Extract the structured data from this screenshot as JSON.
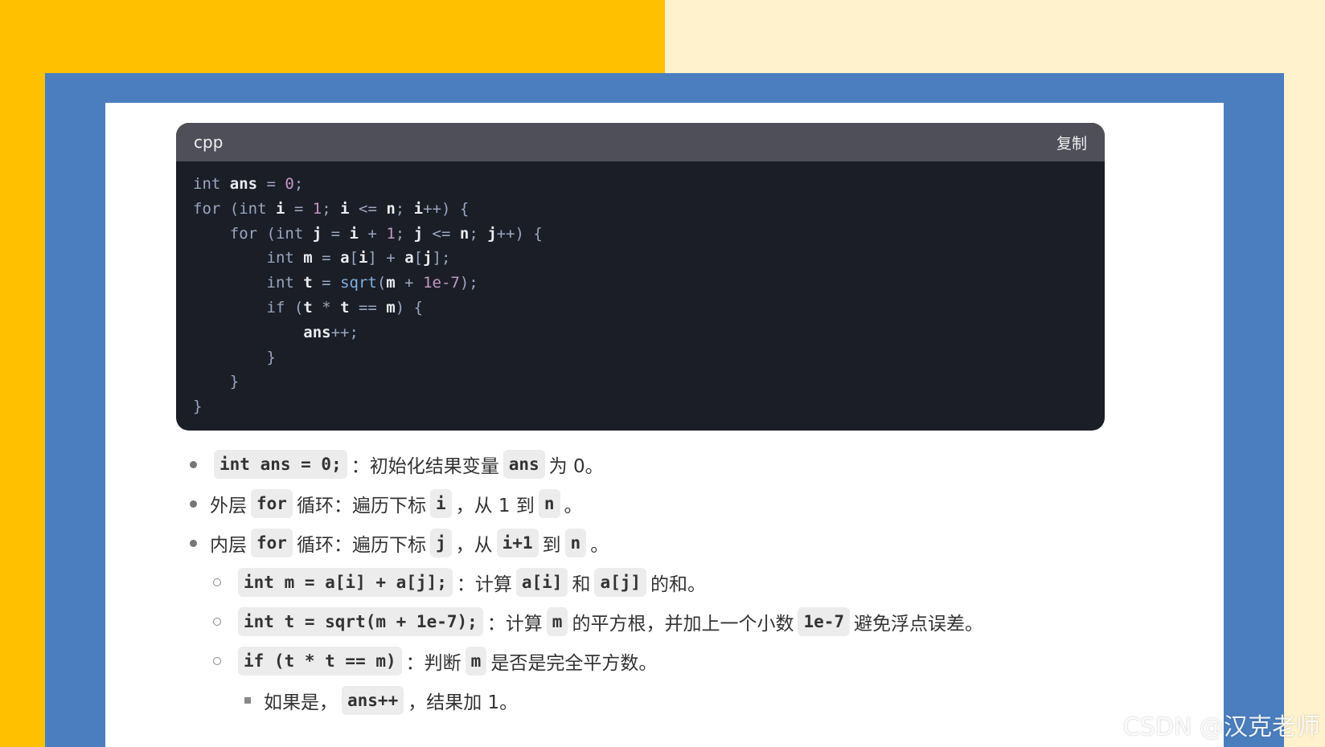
{
  "code_block": {
    "language": "cpp",
    "copy_label": "复制",
    "lines": [
      [
        [
          "kw",
          "int "
        ],
        [
          "id",
          "ans"
        ],
        [
          "op",
          " = "
        ],
        [
          "num",
          "0"
        ],
        [
          "op",
          ";"
        ]
      ],
      [
        [
          "kw",
          "for "
        ],
        [
          "op",
          "("
        ],
        [
          "kw",
          "int "
        ],
        [
          "id",
          "i"
        ],
        [
          "op",
          " = "
        ],
        [
          "num",
          "1"
        ],
        [
          "op",
          "; "
        ],
        [
          "id",
          "i"
        ],
        [
          "op",
          " <= "
        ],
        [
          "id",
          "n"
        ],
        [
          "op",
          "; "
        ],
        [
          "id",
          "i"
        ],
        [
          "op",
          "++) {"
        ]
      ],
      [
        [
          "op",
          "    "
        ],
        [
          "kw",
          "for "
        ],
        [
          "op",
          "("
        ],
        [
          "kw",
          "int "
        ],
        [
          "id",
          "j"
        ],
        [
          "op",
          " = "
        ],
        [
          "id",
          "i"
        ],
        [
          "op",
          " + "
        ],
        [
          "num",
          "1"
        ],
        [
          "op",
          "; "
        ],
        [
          "id",
          "j"
        ],
        [
          "op",
          " <= "
        ],
        [
          "id",
          "n"
        ],
        [
          "op",
          "; "
        ],
        [
          "id",
          "j"
        ],
        [
          "op",
          "++) {"
        ]
      ],
      [
        [
          "op",
          "        "
        ],
        [
          "kw",
          "int "
        ],
        [
          "id",
          "m"
        ],
        [
          "op",
          " = "
        ],
        [
          "id",
          "a"
        ],
        [
          "op",
          "["
        ],
        [
          "id",
          "i"
        ],
        [
          "op",
          "] + "
        ],
        [
          "id",
          "a"
        ],
        [
          "op",
          "["
        ],
        [
          "id",
          "j"
        ],
        [
          "op",
          "];"
        ]
      ],
      [
        [
          "op",
          "        "
        ],
        [
          "kw",
          "int "
        ],
        [
          "id",
          "t"
        ],
        [
          "op",
          " = "
        ],
        [
          "fn",
          "sqrt"
        ],
        [
          "op",
          "("
        ],
        [
          "id",
          "m"
        ],
        [
          "op",
          " + "
        ],
        [
          "num",
          "1e-7"
        ],
        [
          "op",
          ");"
        ]
      ],
      [
        [
          "op",
          "        "
        ],
        [
          "kw",
          "if "
        ],
        [
          "op",
          "("
        ],
        [
          "id",
          "t"
        ],
        [
          "op",
          " * "
        ],
        [
          "id",
          "t"
        ],
        [
          "op",
          " == "
        ],
        [
          "id",
          "m"
        ],
        [
          "op",
          ") {"
        ]
      ],
      [
        [
          "op",
          "            "
        ],
        [
          "id",
          "ans"
        ],
        [
          "op",
          "++;"
        ]
      ],
      [
        [
          "op",
          "        }"
        ]
      ],
      [
        [
          "op",
          "    }"
        ]
      ],
      [
        [
          "op",
          "}"
        ]
      ]
    ]
  },
  "explanations": [
    {
      "level": 1,
      "parts": [
        [
          "code",
          "int ans = 0;"
        ],
        [
          "t",
          "：初始化结果变量"
        ],
        [
          "code",
          "ans"
        ],
        [
          "t",
          "为 0。"
        ]
      ]
    },
    {
      "level": 1,
      "parts": [
        [
          "t",
          "外层"
        ],
        [
          "code",
          "for"
        ],
        [
          "t",
          "循环：遍历下标"
        ],
        [
          "code",
          "i"
        ],
        [
          "t",
          "，从 1 到"
        ],
        [
          "code",
          "n"
        ],
        [
          "t",
          "。"
        ]
      ]
    },
    {
      "level": 1,
      "parts": [
        [
          "t",
          "内层"
        ],
        [
          "code",
          "for"
        ],
        [
          "t",
          "循环：遍历下标"
        ],
        [
          "code",
          "j"
        ],
        [
          "t",
          "，从"
        ],
        [
          "code",
          "i+1"
        ],
        [
          "t",
          "到"
        ],
        [
          "code",
          "n"
        ],
        [
          "t",
          "。"
        ]
      ]
    },
    {
      "level": 2,
      "parts": [
        [
          "code",
          "int m = a[i] + a[j];"
        ],
        [
          "t",
          "：计算"
        ],
        [
          "code",
          "a[i]"
        ],
        [
          "t",
          "和"
        ],
        [
          "code",
          "a[j]"
        ],
        [
          "t",
          "的和。"
        ]
      ]
    },
    {
      "level": 2,
      "parts": [
        [
          "code",
          "int t = sqrt(m + 1e-7);"
        ],
        [
          "t",
          "：计算"
        ],
        [
          "code",
          "m"
        ],
        [
          "t",
          "的平方根，并加上一个小数"
        ],
        [
          "code",
          "1e-7"
        ],
        [
          "t",
          "避免浮点误差。"
        ]
      ]
    },
    {
      "level": 2,
      "parts": [
        [
          "code",
          "if (t * t == m)"
        ],
        [
          "t",
          "：判断"
        ],
        [
          "code",
          "m"
        ],
        [
          "t",
          "是否是完全平方数。"
        ]
      ]
    },
    {
      "level": 3,
      "parts": [
        [
          "t",
          "如果是，"
        ],
        [
          "code",
          "ans++"
        ],
        [
          "t",
          "，结果加 1。"
        ]
      ]
    }
  ],
  "watermark": "CSDN @汉克老师",
  "colors": {
    "left_background": "#ffc000",
    "right_background": "#fff2cc",
    "frame": "#4a7ebf",
    "code_background": "#1b1e27",
    "code_header": "#4e4f58"
  }
}
